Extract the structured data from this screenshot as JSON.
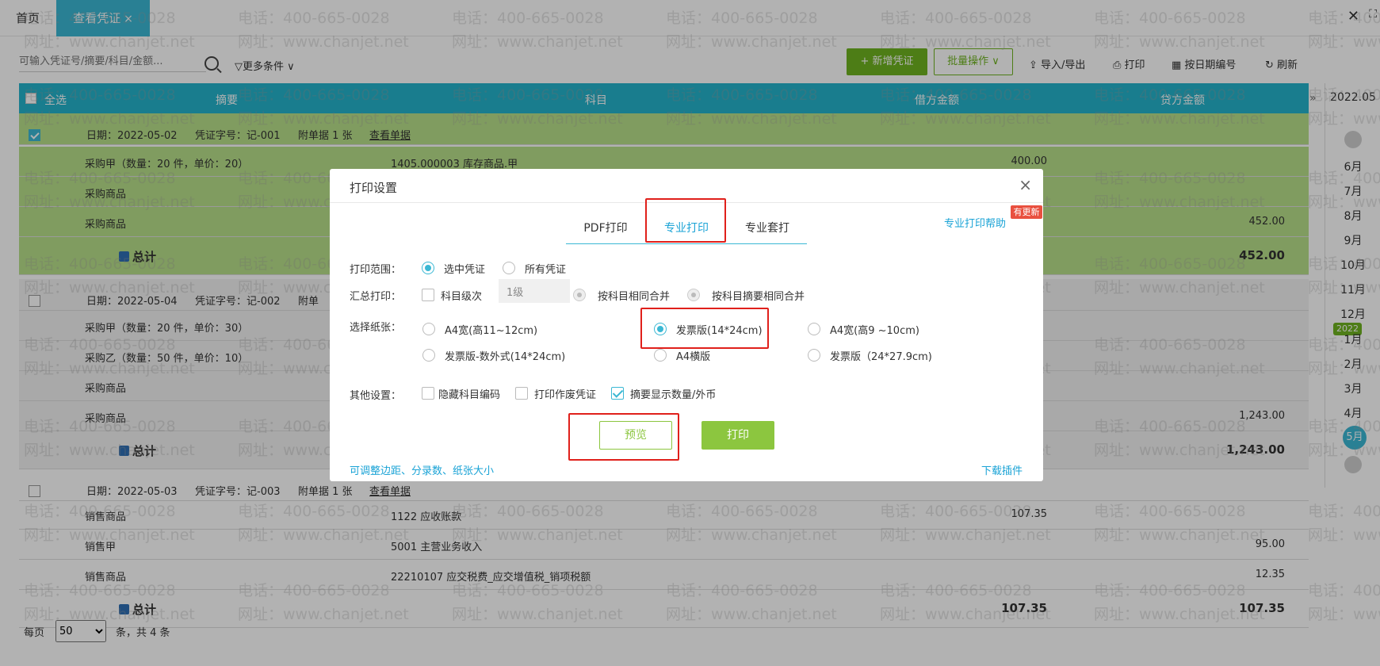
{
  "tabs": {
    "home": "首页",
    "active": "查看凭证",
    "close_glyph": "×"
  },
  "window": {
    "close_glyph": "✕",
    "max_glyph": "⛶"
  },
  "toolbar": {
    "search_placeholder": "可输入凭证号/摘要/科目/金额...",
    "more_conditions": "▽更多条件 ∨",
    "new_voucher": "+ 新增凭证",
    "batch_ops": "批量操作 ∨",
    "import_export": "导入/导出",
    "print": "打印",
    "renumber_by_date": "按日期编号",
    "refresh": "刷新"
  },
  "table": {
    "headers": {
      "select_all": "全选",
      "summary": "摘要",
      "subject": "科目",
      "debit": "借方金额",
      "credit": "贷方金额"
    },
    "groups": [
      {
        "checked": true,
        "date": "日期：2022-05-02",
        "voucher_no": "凭证字号：记-001",
        "attachments": "附单据 1 张",
        "view": "查看单据",
        "rows": [
          {
            "summary": "采购甲（数量：20 件，单价：20）",
            "subject": "1405.000003  库存商品.甲",
            "debit": "400.00",
            "credit": ""
          },
          {
            "summary": "采购商品",
            "subject": "",
            "debit": "",
            "credit": ""
          },
          {
            "summary": "采购商品",
            "subject": "",
            "debit": "",
            "credit": "452.00"
          }
        ],
        "total_label": "总计",
        "total_debit": "",
        "total_credit": "452.00"
      },
      {
        "checked": false,
        "date": "日期：2022-05-04",
        "voucher_no": "凭证字号：记-002",
        "attachments": "附单",
        "view": "",
        "rows": [
          {
            "summary": "采购甲（数量：20 件，单价：30）",
            "subject": "",
            "debit": "",
            "credit": ""
          },
          {
            "summary": "采购乙（数量：50 件，单价：10）",
            "subject": "",
            "debit": "",
            "credit": ""
          },
          {
            "summary": "采购商品",
            "subject": "",
            "debit": "",
            "credit": ""
          },
          {
            "summary": "采购商品",
            "subject": "",
            "debit": "",
            "credit": "1,243.00"
          }
        ],
        "total_label": "总计",
        "total_debit": "",
        "total_credit": "1,243.00"
      },
      {
        "checked": false,
        "date": "日期：2022-05-03",
        "voucher_no": "凭证字号：记-003",
        "attachments": "附单据 1 张",
        "view": "查看单据",
        "rows": [
          {
            "summary": "销售商品",
            "subject": "1122 应收账款",
            "debit": "107.35",
            "credit": ""
          },
          {
            "summary": "销售甲",
            "subject": "5001 主营业务收入",
            "debit": "",
            "credit": "95.00"
          },
          {
            "summary": "销售商品",
            "subject": "22210107 应交税费_应交增值税_销项税额",
            "debit": "",
            "credit": "12.35"
          }
        ],
        "total_label": "总计",
        "total_debit": "107.35",
        "total_credit": "107.35"
      }
    ]
  },
  "footer": {
    "per_page_label": "每页",
    "per_page_value": "50",
    "total_text": "条，共 4 条"
  },
  "datestrip": {
    "current": "2022.05",
    "months_prev": [
      "6月",
      "7月",
      "8月",
      "9月",
      "10月",
      "11月",
      "12月"
    ],
    "year_badge": "2022",
    "months": [
      "1月",
      "2月",
      "3月",
      "4月"
    ],
    "active_month": "5月",
    "expander": "»"
  },
  "watermark": {
    "phone": "电话：400-665-0028",
    "site": "网址：www.chanjet.net"
  },
  "dialog": {
    "title": "打印设置",
    "close_glyph": "×",
    "tabs": [
      "PDF打印",
      "专业打印",
      "专业套打"
    ],
    "active_tab": "专业打印",
    "help_link": "专业打印帮助",
    "new_badge": "有更新",
    "range": {
      "label": "打印范围：",
      "options": [
        "选中凭证",
        "所有凭证"
      ],
      "selected": "选中凭证"
    },
    "summary_print": {
      "label": "汇总打印：",
      "level_checkbox": "科目级次",
      "level_value": "1级",
      "merge_subject": "按科目相同合并",
      "merge_subject_summary": "按科目摘要相同合并"
    },
    "paper": {
      "label": "选择纸张：",
      "options": [
        "A4宽(高11~12cm)",
        "发票版(14*24cm)",
        "A4宽(高9 ~10cm)",
        "发票版-数外式(14*24cm)",
        "A4横版",
        "发票版（24*27.9cm)"
      ],
      "selected": "发票版(14*24cm)"
    },
    "other": {
      "label": "其他设置：",
      "hide_code": "隐藏科目编码",
      "print_void": "打印作废凭证",
      "show_qty": "摘要显示数量/外币"
    },
    "preview": "预览",
    "print": "打印",
    "adjust_link": "可调整边距、分录数、纸张大小",
    "download_link": "下载插件"
  },
  "colors": {
    "accent": "#3bb8d4",
    "green": "#8cc63f",
    "highlight": "#e0201b"
  }
}
